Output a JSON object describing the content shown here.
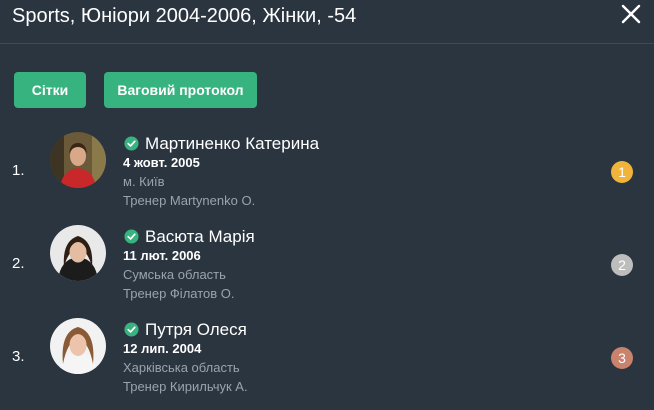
{
  "header": {
    "title": "Sports, Юніори 2004-2006, Жінки, -54"
  },
  "toolbar": {
    "grids_label": "Сітки",
    "weigh_in_label": "Ваговий протокол"
  },
  "colors": {
    "accent": "#36b37e",
    "background": "#2b3540",
    "gold": "#f0b43a",
    "silver": "#bdbdbd",
    "bronze": "#c9826b"
  },
  "results": [
    {
      "place": "1.",
      "name": "Мартиненко Катерина",
      "dob": "4 жовт. 2005",
      "region": "м. Київ",
      "coach": "Тренер Martynenko O.",
      "medal": "1",
      "medal_color": "#f0b43a",
      "verified_icon": "check-circle-icon"
    },
    {
      "place": "2.",
      "name": "Васюта Марія",
      "dob": "11 лют. 2006",
      "region": "Сумська область",
      "coach": "Тренер Філатов О.",
      "medal": "2",
      "medal_color": "#bdbdbd",
      "verified_icon": "check-circle-icon"
    },
    {
      "place": "3.",
      "name": "Путря Олеся",
      "dob": "12 лип. 2004",
      "region": "Харківська область",
      "coach": "Тренер Кирильчук А.",
      "medal": "3",
      "medal_color": "#c9826b",
      "verified_icon": "check-circle-icon"
    }
  ]
}
